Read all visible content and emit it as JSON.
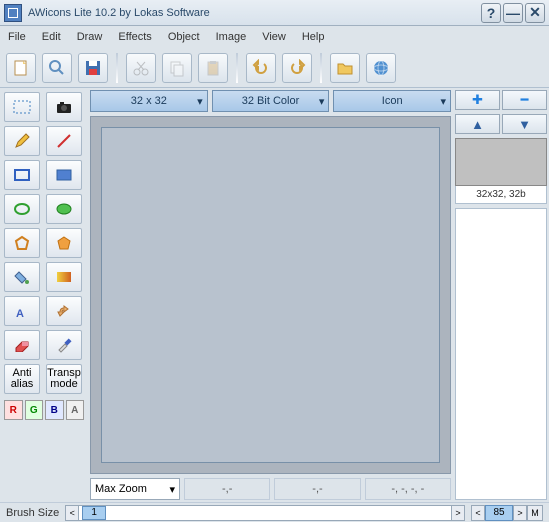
{
  "title": "AWicons Lite 10.2 by Lokas Software",
  "menu": [
    "File",
    "Edit",
    "Draw",
    "Effects",
    "Object",
    "Image",
    "View",
    "Help"
  ],
  "dropdowns": {
    "size": "32 x 32",
    "color": "32 Bit Color",
    "type": "Icon"
  },
  "zoom": "Max Zoom",
  "coords": [
    "-,-",
    "-,-",
    "-, -, -, -"
  ],
  "preview_label": "32x32, 32b",
  "tools_text": {
    "antialias": "Anti\nalias",
    "transp": "Transp\nmode"
  },
  "rgba": [
    "R",
    "G",
    "B",
    "A"
  ],
  "brush_label": "Brush Size",
  "brush_value": "1",
  "right_value": "85",
  "m_label": "M",
  "winbtns": {
    "help": "?",
    "min": "—",
    "close": "✕"
  },
  "nav": {
    "plus": "✚",
    "minus": "━",
    "up": "▲",
    "down": "▼"
  }
}
